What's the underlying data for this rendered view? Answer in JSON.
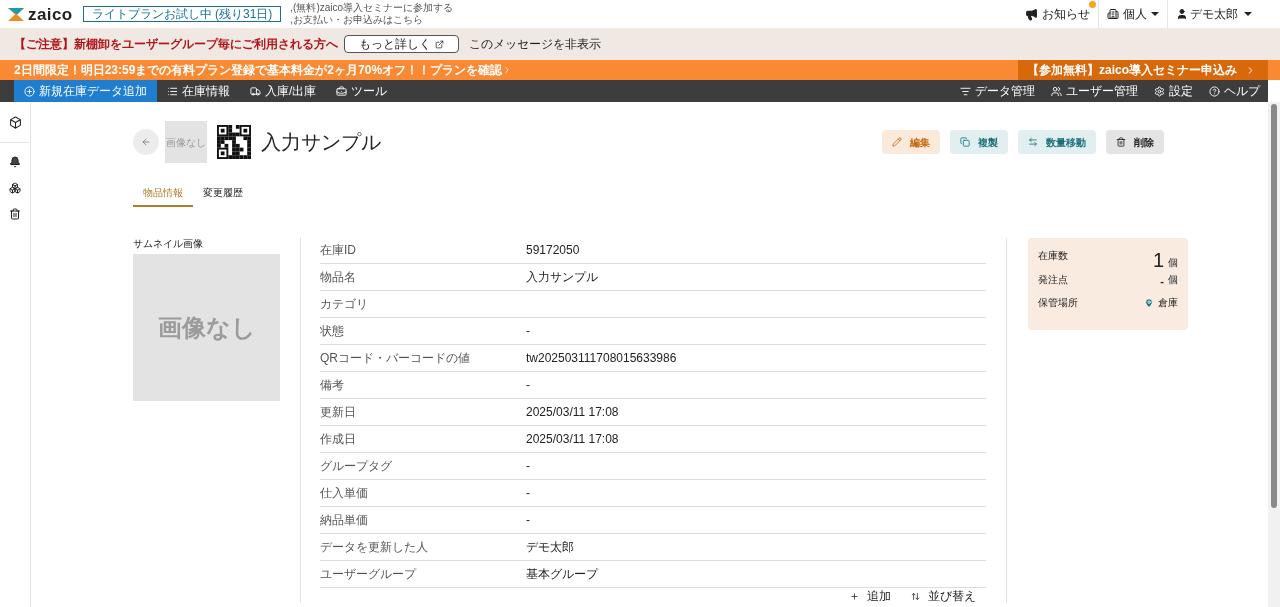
{
  "header": {
    "logo": "zaico",
    "trial_badge": "ライトプランお試し中 (残り31日)",
    "links": [
      ",(無料)zaico導入セミナーに参加する",
      ",お支払い・お申込みはこちら"
    ],
    "notifications": {
      "label": "お知らせ",
      "unread": true
    },
    "workspace": "個人",
    "user": "デモ太郎"
  },
  "notice": {
    "text": "【ご注意】新棚卸をユーザーグループ毎にご利用される方へ",
    "button": "もっと詳しく",
    "dismiss": "このメッセージを非表示"
  },
  "promo": {
    "text": "2日間限定！明日23:59までの有料プラン登録で基本料金が2ヶ月70%オフ！！",
    "link": "プランを確認",
    "seminar": "【参加無料】zaico導入セミナー申込み"
  },
  "nav": {
    "left": [
      {
        "label": "新規在庫データ追加",
        "kind": "add",
        "selected": true
      },
      {
        "label": "在庫情報",
        "kind": "list",
        "selected": false
      },
      {
        "label": "入庫/出庫",
        "kind": "inout",
        "selected": false
      },
      {
        "label": "ツール",
        "kind": "tool",
        "selected": false
      }
    ],
    "right": [
      {
        "label": "データ管理",
        "kind": "data"
      },
      {
        "label": "ユーザー管理",
        "kind": "users"
      },
      {
        "label": "設定",
        "kind": "settings"
      },
      {
        "label": "ヘルプ",
        "kind": "help"
      }
    ]
  },
  "item": {
    "thumb_small": "画像なし",
    "title": "入力サンプル"
  },
  "actions": [
    {
      "label": "編集",
      "kind": "edit"
    },
    {
      "label": "複製",
      "kind": "copy"
    },
    {
      "label": "数量移動",
      "kind": "move"
    },
    {
      "label": "削除",
      "kind": "delete"
    }
  ],
  "tabs": [
    {
      "label": "物品情報",
      "selected": true
    },
    {
      "label": "変更履歴",
      "selected": false
    }
  ],
  "thumbnail": {
    "label": "サムネイル画像",
    "no_image": "画像なし"
  },
  "fields": [
    {
      "label": "在庫ID",
      "value": "59172050"
    },
    {
      "label": "物品名",
      "value": "入力サンプル"
    },
    {
      "label": "カテゴリ"
    },
    {
      "label": "状態",
      "value": "-"
    },
    {
      "label": "QRコード・バーコードの値",
      "value": "tw202503111708015633986"
    },
    {
      "label": "備考",
      "value": "-"
    },
    {
      "label": "更新日",
      "value": "2025/03/11 17:08"
    },
    {
      "label": "作成日",
      "value": "2025/03/11 17:08"
    },
    {
      "label": "グループタグ",
      "value": "-"
    },
    {
      "label": "仕入単価",
      "value": "-"
    },
    {
      "label": "納品単価",
      "value": "-"
    },
    {
      "label": "データを更新した人",
      "value": "デモ太郎"
    },
    {
      "label": "ユーザーグループ",
      "value": "基本グループ"
    }
  ],
  "field_actions": [
    "追加",
    "並び替え"
  ],
  "stock": {
    "quantity_label": "在庫数",
    "quantity": "1",
    "unit": "個",
    "reorder_label": "発注点",
    "reorder": "-",
    "reorder_unit": "個",
    "location_label": "保管場所",
    "location": "倉庫"
  }
}
